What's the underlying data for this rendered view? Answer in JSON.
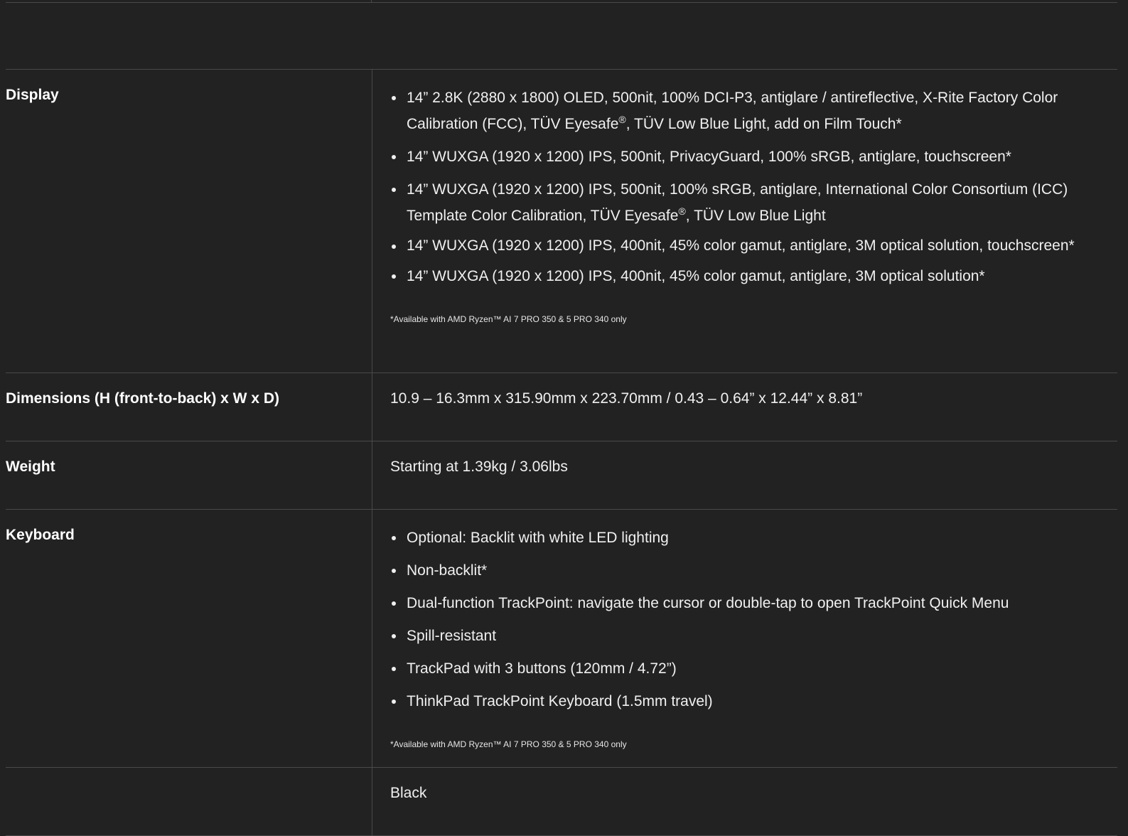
{
  "section": {
    "header": "",
    "rows": [
      {
        "label": "Display",
        "items": [
          {
            "text_before_mark": "14” 2.8K (2880 x 1800) OLED, 500nit, 100% DCI-P3, antiglare / antireflective, X-Rite Factory Color Calibration (FCC), TÜV Eyesafe",
            "mark": "®",
            "text_after_mark": ", TÜV Low Blue Light, add on Film Touch*"
          },
          {
            "text_before_mark": "14” WUXGA (1920 x 1200) IPS, 500nit, PrivacyGuard, 100% sRGB, antiglare, touchscreen*",
            "mark": "",
            "text_after_mark": ""
          },
          {
            "text_before_mark": "14” WUXGA (1920 x 1200) IPS, 500nit, 100% sRGB, antiglare, International Color Consortium (ICC) Template Color Calibration, TÜV Eyesafe",
            "mark": "®",
            "text_after_mark": ", TÜV Low Blue Light"
          },
          {
            "text_before_mark": "14” WUXGA (1920 x 1200) IPS, 400nit, 45% color gamut, antiglare, 3M optical solution, touchscreen*",
            "mark": "",
            "text_after_mark": ""
          },
          {
            "text_before_mark": "14” WUXGA (1920 x 1200) IPS, 400nit, 45% color gamut, antiglare, 3M optical solution*",
            "mark": "",
            "text_after_mark": ""
          }
        ],
        "footnote": "*Available with AMD Ryzen™ AI 7 PRO 350 & 5 PRO 340 only"
      },
      {
        "label": "Dimensions (H (front-to-back) x W x D)",
        "value": "10.9 – 16.3mm x 315.90mm x 223.70mm / 0.43 – 0.64” x 12.44” x 8.81”"
      },
      {
        "label": "Weight",
        "value": "Starting at 1.39kg / 3.06lbs"
      },
      {
        "label": "Keyboard",
        "items": [
          "Optional: Backlit with white LED lighting",
          "Non-backlit*",
          "Dual-function TrackPoint: navigate the cursor or double-tap to open TrackPoint Quick Menu",
          "Spill-resistant",
          "TrackPad with 3 buttons (120mm / 4.72”)",
          "ThinkPad TrackPoint Keyboard (1.5mm travel)"
        ],
        "footnote": "*Available with AMD Ryzen™ AI 7 PRO 350 & 5 PRO 340 only"
      },
      {
        "label": "",
        "value": "Black"
      }
    ]
  }
}
